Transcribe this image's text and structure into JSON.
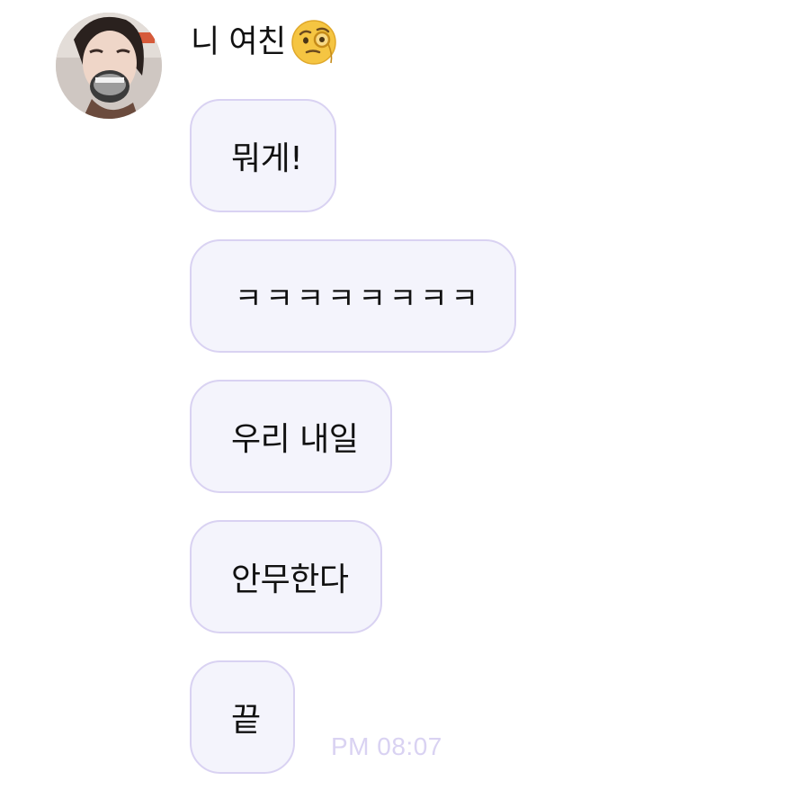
{
  "sender": {
    "name": "니 여친",
    "emoji": "face-with-monocle",
    "avatar": "profile-photo"
  },
  "messages": [
    {
      "text": "뭐게!"
    },
    {
      "text": "ㅋㅋㅋㅋㅋㅋㅋㅋ"
    },
    {
      "text": "우리 내일"
    },
    {
      "text": "안무한다"
    },
    {
      "text": "끝"
    }
  ],
  "timestamp": "PM 08:07",
  "colors": {
    "bubble_bg": "#f4f4fc",
    "bubble_border": "#d9d2f2",
    "timestamp": "#d9d2f2",
    "text": "#111111"
  }
}
